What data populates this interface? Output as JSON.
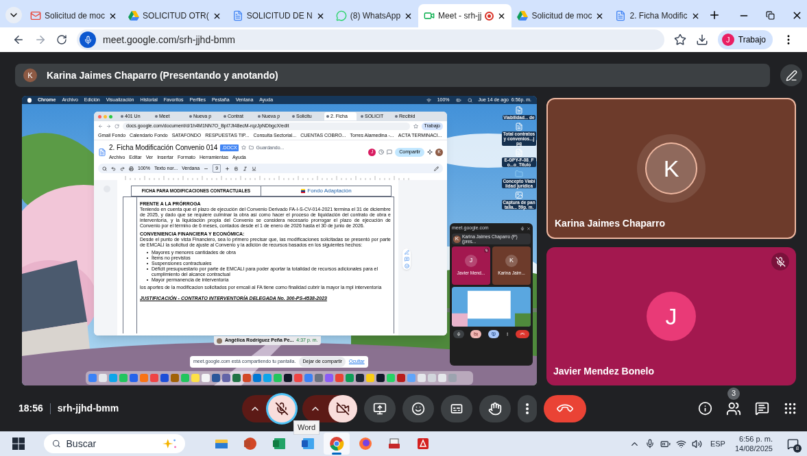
{
  "browser": {
    "tabs": [
      {
        "kind": "gmail",
        "title": "Solicitud de moc",
        "selected": false,
        "recording": false
      },
      {
        "kind": "drive",
        "title": "SOLICITUD OTR(",
        "selected": false,
        "recording": false
      },
      {
        "kind": "docs",
        "title": "SOLICITUD DE N",
        "selected": false,
        "recording": false
      },
      {
        "kind": "whatsapp",
        "title": "(8) WhatsApp",
        "selected": false,
        "recording": false
      },
      {
        "kind": "meet",
        "title": "Meet - srh-jj",
        "selected": true,
        "recording": true
      },
      {
        "kind": "drive",
        "title": "Solicitud de moc",
        "selected": false,
        "recording": false
      },
      {
        "kind": "docs",
        "title": "2. Ficha Modific",
        "selected": false,
        "recording": false
      }
    ],
    "url": "meet.google.com/srh-jjhd-bmm",
    "profile": {
      "initial": "J",
      "label": "Trabajo"
    }
  },
  "meet": {
    "presenter": {
      "initial": "K",
      "title": "Karina Jaimes Chaparro (Presentando y anotando)"
    },
    "shared_screen": {
      "menu_bar": {
        "app": "Chrome",
        "items": [
          "Archivo",
          "Edición",
          "Visualización",
          "Historial",
          "Favoritos",
          "Perfiles",
          "Pestaña",
          "Ventana",
          "Ayuda"
        ],
        "battery": "100%",
        "clock": "Jue 14 de ago  6:56p. m."
      },
      "docs_window": {
        "tabs": [
          {
            "title": "401 Un",
            "selected": false
          },
          {
            "title": "Meet",
            "selected": false
          },
          {
            "title": "Nueva p",
            "selected": false
          },
          {
            "title": "Contrat",
            "selected": false
          },
          {
            "title": "Nueva p",
            "selected": false
          },
          {
            "title": "Solicitu",
            "selected": false
          },
          {
            "title": "2. Ficha",
            "selected": true
          },
          {
            "title": "SOLICIT",
            "selected": false
          },
          {
            "title": "Recibid",
            "selected": false
          }
        ],
        "url": "docs.google.com/document/d/1h4M1NN7O_Bpl7Jt48ecM-rqzJpNDbgcX/edit",
        "profile": "Trabajo",
        "bookmarks": [
          "Gmail Fondo",
          "Calendario Fondo",
          "SATAFONDO",
          "RESPUESTAS TIP...",
          "Consulta Sectorial...",
          "CUENTAS COBRO...",
          "Torres Alamedina -...",
          "ACTA TERMINACI..."
        ],
        "doc_title": "2. Ficha Modificación Convenio 014",
        "badge": ".DOCX",
        "status": "Guardando...",
        "menus": [
          "Archivo",
          "Editar",
          "Ver",
          "Insertar",
          "Formato",
          "Herramientas",
          "Ayuda"
        ],
        "zoom": "100%",
        "style": "Texto nor...",
        "font": "Verdana",
        "font_size": "9",
        "share": "Compartir",
        "user_initial": "J",
        "owner_initial": "K",
        "document": {
          "header": "FICHA PARA MODIFICACIONES CONTRACTUALES",
          "logo": "Fondo Adaptación",
          "blocks": [
            {
              "kind": "heading",
              "text": "FRENTE A LA PRÓRROGA"
            },
            {
              "kind": "paragraph",
              "text": "Teniendo en cuenta que el plazo de ejecución del Convenio Derivado FA-I-S-CV-014-2021 termina el 31 de diciembre de 2025, y dado que se requiere culminar la obra así como hacer el proceso de liquidación del contrato de obra e interventoría, y la liquidación propia del Convenio se considera necesario prorrogar el plazo de ejecución de Convenio por el término de 6 meses, contados desde el 1 de enero de 2026 hasta el 30 de junio de 2026."
            },
            {
              "kind": "heading",
              "text": "CONVENIENCIA FINANCIERA Y ECONÓMICA:"
            },
            {
              "kind": "paragraph",
              "text": "Desde el punto de vista Financiero, sea lo primero precisar que, las modificaciones solicitadas se presentó por parte de EMCALI la solicitud de ajuste al Convenio y la adición de recursos basados en los siguientes hechos:"
            },
            {
              "kind": "bullets",
              "items": [
                "Mayores y menores cantidades de obra",
                "Ítems no previstos",
                "Suspensiones contractuales",
                "Déficit presupuestario por parte de EMCALI para poder aportar la totalidad de recursos adicionales para el cumplimiento del alcance contractual",
                "Mayor permanencia de interventoría"
              ]
            },
            {
              "kind": "paragraph",
              "text": "los aportes de la modificacion solicitados por emcali al FA tiene como finalidad cubrir la mayor la mpl interventoría"
            },
            {
              "kind": "title",
              "text": "JUSTIFICACIÓN - CONTRATO INTERVENTORÍA DELEGADA No. 300-PS-4538-2023"
            }
          ]
        }
      },
      "notification": {
        "name": "Angélica Rodríguez Peña Pe...",
        "time": "4:37 p. m."
      },
      "share_bar": {
        "message": "meet.google.com está compartiendo tu pantalla.",
        "stop": "Dejar de compartir",
        "hide": "Ocultar"
      },
      "desktop_icons": [
        {
          "kind": "document",
          "label": "Viabilidad... de"
        },
        {
          "kind": "document",
          "label": "Total contratos y convenios...jpg"
        },
        {
          "kind": "document",
          "label": "E-GPY-F-08_Fo...o_Titulo"
        },
        {
          "kind": "folder",
          "label": "Concepto Viabilidad jurídica"
        },
        {
          "kind": "screenshot",
          "label": "Captura de pantalla... 59p. m."
        }
      ],
      "pip": {
        "url": "meet.google.com",
        "presenter_initial": "K",
        "presenter": "Karina Jaimes Chaparro (P) (pres...",
        "tiles": [
          {
            "name": "Javier Mend...",
            "initial": "J",
            "muted": true,
            "color": "#a3184f"
          },
          {
            "name": "Karina Jaim...",
            "initial": "K",
            "muted": false,
            "color": "#6d3b2b"
          }
        ]
      }
    },
    "participants": [
      {
        "name": "Karina Jaimes Chaparro",
        "initial": "K",
        "color": "#6d3b2b",
        "speaking": true,
        "muted": false
      },
      {
        "name": "Javier Mendez Bonelo",
        "initial": "J",
        "color": "#a3184f",
        "speaking": false,
        "muted": true
      }
    ],
    "time": "18:56",
    "meeting_code": "srh-jjhd-bmm",
    "mic": {
      "on": false,
      "focused": true
    },
    "camera": {
      "on": false
    },
    "people_count": "3"
  },
  "tooltip": "Word",
  "taskbar": {
    "search_placeholder": "Buscar",
    "apps": [
      {
        "kind": "explorer",
        "selected": false
      },
      {
        "kind": "powerpoint",
        "selected": false
      },
      {
        "kind": "excel",
        "selected": false
      },
      {
        "kind": "word",
        "selected": false
      },
      {
        "kind": "chrome",
        "selected": true
      },
      {
        "kind": "firefox",
        "selected": false
      },
      {
        "kind": "printer",
        "selected": false
      },
      {
        "kind": "acrobat",
        "selected": false
      }
    ],
    "language": "ESP",
    "time": "6:56 p. m.",
    "date": "14/08/2025",
    "notifications": "8"
  }
}
